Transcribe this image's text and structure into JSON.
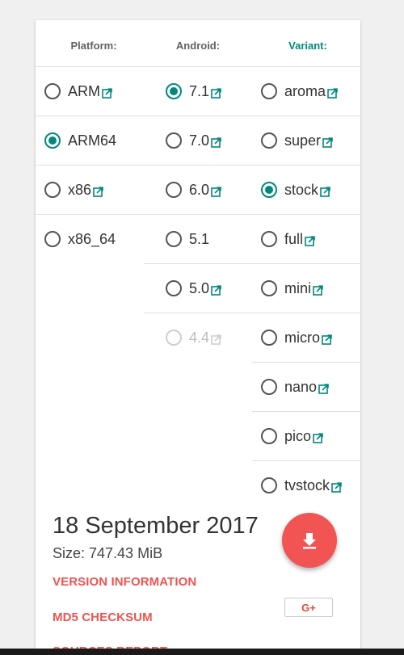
{
  "headers": {
    "platform": "Platform:",
    "android": "Android:",
    "variant": "Variant:"
  },
  "colors": {
    "accent": "#00897b",
    "fab": "#f25353",
    "link": "#ef5350"
  },
  "platform": [
    {
      "label": "ARM",
      "checked": false,
      "link": true
    },
    {
      "label": "ARM64",
      "checked": true,
      "link": false
    },
    {
      "label": "x86",
      "checked": false,
      "link": true
    },
    {
      "label": "x86_64",
      "checked": false,
      "link": false
    }
  ],
  "android": [
    {
      "label": "7.1",
      "checked": true,
      "link": true
    },
    {
      "label": "7.0",
      "checked": false,
      "link": true
    },
    {
      "label": "6.0",
      "checked": false,
      "link": true
    },
    {
      "label": "5.1",
      "checked": false,
      "link": false
    },
    {
      "label": "5.0",
      "checked": false,
      "link": true
    },
    {
      "label": "4.4",
      "checked": false,
      "link": true,
      "disabled": true
    }
  ],
  "variant": [
    {
      "label": "aroma",
      "checked": false,
      "link": true
    },
    {
      "label": "super",
      "checked": false,
      "link": true
    },
    {
      "label": "stock",
      "checked": true,
      "link": true
    },
    {
      "label": "full",
      "checked": false,
      "link": true
    },
    {
      "label": "mini",
      "checked": false,
      "link": true
    },
    {
      "label": "micro",
      "checked": false,
      "link": true
    },
    {
      "label": "nano",
      "checked": false,
      "link": true
    },
    {
      "label": "pico",
      "checked": false,
      "link": true
    },
    {
      "label": "tvstock",
      "checked": false,
      "link": true
    }
  ],
  "release": {
    "date": "18 September 2017",
    "size": "Size: 747.43 MiB"
  },
  "links": {
    "version": "VERSION INFORMATION",
    "md5": "MD5 CHECKSUM",
    "sources": "SOURCES REPORT"
  },
  "share": {
    "gplus": "G+"
  },
  "icons": {
    "download": "download-icon",
    "external": "external-link-icon"
  }
}
